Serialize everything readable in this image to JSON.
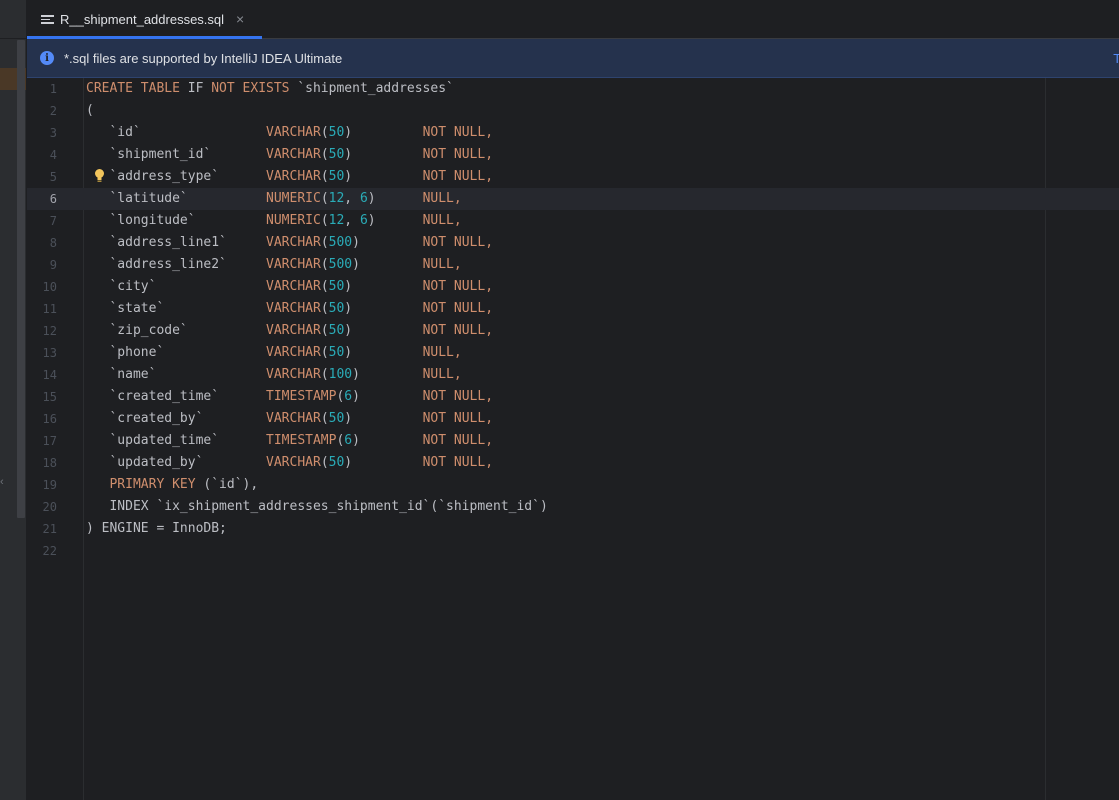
{
  "tab": {
    "label": "R__shipment_addresses.sql",
    "close": "×"
  },
  "banner": {
    "message": "*.sql files are supported by IntelliJ IDEA Ultimate",
    "action": "Tr"
  },
  "editor": {
    "lines": [
      {
        "n": "1",
        "parts": [
          {
            "t": "CREATE TABLE ",
            "c": "kw"
          },
          {
            "t": "IF ",
            "c": "id"
          },
          {
            "t": "NOT EXISTS ",
            "c": "kw"
          },
          {
            "t": "`shipment_addresses`",
            "c": "id"
          }
        ]
      },
      {
        "n": "2",
        "parts": [
          {
            "t": "(",
            "c": "id"
          }
        ]
      },
      {
        "n": "3",
        "parts": [
          {
            "t": "   `id`                ",
            "c": "id"
          },
          {
            "t": "VARCHAR",
            "c": "kw"
          },
          {
            "t": "(",
            "c": "id"
          },
          {
            "t": "50",
            "c": "num"
          },
          {
            "t": ")         ",
            "c": "id"
          },
          {
            "t": "NOT NULL",
            "c": "kw"
          },
          {
            "t": ",",
            "c": "kw"
          }
        ]
      },
      {
        "n": "4",
        "parts": [
          {
            "t": "   `shipment_id`       ",
            "c": "id"
          },
          {
            "t": "VARCHAR",
            "c": "kw"
          },
          {
            "t": "(",
            "c": "id"
          },
          {
            "t": "50",
            "c": "num"
          },
          {
            "t": ")         ",
            "c": "id"
          },
          {
            "t": "NOT NULL",
            "c": "kw"
          },
          {
            "t": ",",
            "c": "kw"
          }
        ]
      },
      {
        "n": "5",
        "bulb": true,
        "parts": [
          {
            "t": "   `address_type`      ",
            "c": "id"
          },
          {
            "t": "VARCHAR",
            "c": "kw"
          },
          {
            "t": "(",
            "c": "id"
          },
          {
            "t": "50",
            "c": "num"
          },
          {
            "t": ")         ",
            "c": "id"
          },
          {
            "t": "NOT NULL",
            "c": "kw"
          },
          {
            "t": ",",
            "c": "kw"
          }
        ]
      },
      {
        "n": "6",
        "current": true,
        "parts": [
          {
            "t": "   `latitude`          ",
            "c": "id"
          },
          {
            "t": "NUMERIC",
            "c": "kw"
          },
          {
            "t": "(",
            "c": "id"
          },
          {
            "t": "12",
            "c": "num"
          },
          {
            "t": ", ",
            "c": "id"
          },
          {
            "t": "6",
            "c": "num"
          },
          {
            "t": ")      ",
            "c": "id"
          },
          {
            "t": "NULL",
            "c": "kw"
          },
          {
            "t": ",",
            "c": "kw"
          }
        ]
      },
      {
        "n": "7",
        "parts": [
          {
            "t": "   `longitude`         ",
            "c": "id"
          },
          {
            "t": "NUMERIC",
            "c": "kw"
          },
          {
            "t": "(",
            "c": "id"
          },
          {
            "t": "12",
            "c": "num"
          },
          {
            "t": ", ",
            "c": "id"
          },
          {
            "t": "6",
            "c": "num"
          },
          {
            "t": ")      ",
            "c": "id"
          },
          {
            "t": "NULL",
            "c": "kw"
          },
          {
            "t": ",",
            "c": "kw"
          }
        ]
      },
      {
        "n": "8",
        "parts": [
          {
            "t": "   `address_line1`     ",
            "c": "id"
          },
          {
            "t": "VARCHAR",
            "c": "kw"
          },
          {
            "t": "(",
            "c": "id"
          },
          {
            "t": "500",
            "c": "num"
          },
          {
            "t": ")        ",
            "c": "id"
          },
          {
            "t": "NOT NULL",
            "c": "kw"
          },
          {
            "t": ",",
            "c": "kw"
          }
        ]
      },
      {
        "n": "9",
        "parts": [
          {
            "t": "   `address_line2`     ",
            "c": "id"
          },
          {
            "t": "VARCHAR",
            "c": "kw"
          },
          {
            "t": "(",
            "c": "id"
          },
          {
            "t": "500",
            "c": "num"
          },
          {
            "t": ")        ",
            "c": "id"
          },
          {
            "t": "NULL",
            "c": "kw"
          },
          {
            "t": ",",
            "c": "kw"
          }
        ]
      },
      {
        "n": "10",
        "parts": [
          {
            "t": "   `city`              ",
            "c": "id"
          },
          {
            "t": "VARCHAR",
            "c": "kw"
          },
          {
            "t": "(",
            "c": "id"
          },
          {
            "t": "50",
            "c": "num"
          },
          {
            "t": ")         ",
            "c": "id"
          },
          {
            "t": "NOT NULL",
            "c": "kw"
          },
          {
            "t": ",",
            "c": "kw"
          }
        ]
      },
      {
        "n": "11",
        "parts": [
          {
            "t": "   `state`             ",
            "c": "id"
          },
          {
            "t": "VARCHAR",
            "c": "kw"
          },
          {
            "t": "(",
            "c": "id"
          },
          {
            "t": "50",
            "c": "num"
          },
          {
            "t": ")         ",
            "c": "id"
          },
          {
            "t": "NOT NULL",
            "c": "kw"
          },
          {
            "t": ",",
            "c": "kw"
          }
        ]
      },
      {
        "n": "12",
        "parts": [
          {
            "t": "   `zip_code`          ",
            "c": "id"
          },
          {
            "t": "VARCHAR",
            "c": "kw"
          },
          {
            "t": "(",
            "c": "id"
          },
          {
            "t": "50",
            "c": "num"
          },
          {
            "t": ")         ",
            "c": "id"
          },
          {
            "t": "NOT NULL",
            "c": "kw"
          },
          {
            "t": ",",
            "c": "kw"
          }
        ]
      },
      {
        "n": "13",
        "parts": [
          {
            "t": "   `phone`             ",
            "c": "id"
          },
          {
            "t": "VARCHAR",
            "c": "kw"
          },
          {
            "t": "(",
            "c": "id"
          },
          {
            "t": "50",
            "c": "num"
          },
          {
            "t": ")         ",
            "c": "id"
          },
          {
            "t": "NULL",
            "c": "kw"
          },
          {
            "t": ",",
            "c": "kw"
          }
        ]
      },
      {
        "n": "14",
        "parts": [
          {
            "t": "   `name`              ",
            "c": "id"
          },
          {
            "t": "VARCHAR",
            "c": "kw"
          },
          {
            "t": "(",
            "c": "id"
          },
          {
            "t": "100",
            "c": "num"
          },
          {
            "t": ")        ",
            "c": "id"
          },
          {
            "t": "NULL",
            "c": "kw"
          },
          {
            "t": ",",
            "c": "kw"
          }
        ]
      },
      {
        "n": "15",
        "parts": [
          {
            "t": "   `created_time`      ",
            "c": "id"
          },
          {
            "t": "TIMESTAMP",
            "c": "kw"
          },
          {
            "t": "(",
            "c": "id"
          },
          {
            "t": "6",
            "c": "num"
          },
          {
            "t": ")        ",
            "c": "id"
          },
          {
            "t": "NOT NULL",
            "c": "kw"
          },
          {
            "t": ",",
            "c": "kw"
          }
        ]
      },
      {
        "n": "16",
        "parts": [
          {
            "t": "   `created_by`        ",
            "c": "id"
          },
          {
            "t": "VARCHAR",
            "c": "kw"
          },
          {
            "t": "(",
            "c": "id"
          },
          {
            "t": "50",
            "c": "num"
          },
          {
            "t": ")         ",
            "c": "id"
          },
          {
            "t": "NOT NULL",
            "c": "kw"
          },
          {
            "t": ",",
            "c": "kw"
          }
        ]
      },
      {
        "n": "17",
        "parts": [
          {
            "t": "   `updated_time`      ",
            "c": "id"
          },
          {
            "t": "TIMESTAMP",
            "c": "kw"
          },
          {
            "t": "(",
            "c": "id"
          },
          {
            "t": "6",
            "c": "num"
          },
          {
            "t": ")        ",
            "c": "id"
          },
          {
            "t": "NOT NULL",
            "c": "kw"
          },
          {
            "t": ",",
            "c": "kw"
          }
        ]
      },
      {
        "n": "18",
        "parts": [
          {
            "t": "   `updated_by`        ",
            "c": "id"
          },
          {
            "t": "VARCHAR",
            "c": "kw"
          },
          {
            "t": "(",
            "c": "id"
          },
          {
            "t": "50",
            "c": "num"
          },
          {
            "t": ")         ",
            "c": "id"
          },
          {
            "t": "NOT NULL",
            "c": "kw"
          },
          {
            "t": ",",
            "c": "kw"
          }
        ]
      },
      {
        "n": "19",
        "parts": [
          {
            "t": "   ",
            "c": "id"
          },
          {
            "t": "PRIMARY KEY ",
            "c": "kw"
          },
          {
            "t": "(`id`),",
            "c": "id"
          }
        ]
      },
      {
        "n": "20",
        "parts": [
          {
            "t": "   INDEX `ix_shipment_addresses_shipment_id`(`shipment_id`)",
            "c": "id"
          }
        ]
      },
      {
        "n": "21",
        "parts": [
          {
            "t": ") ENGINE = InnoDB;",
            "c": "id"
          }
        ]
      },
      {
        "n": "22",
        "parts": []
      }
    ]
  },
  "colors": {
    "keyword": "#cf8e6d",
    "number": "#2aacb8",
    "identifier": "#bcbec4",
    "accent": "#3574f0"
  }
}
